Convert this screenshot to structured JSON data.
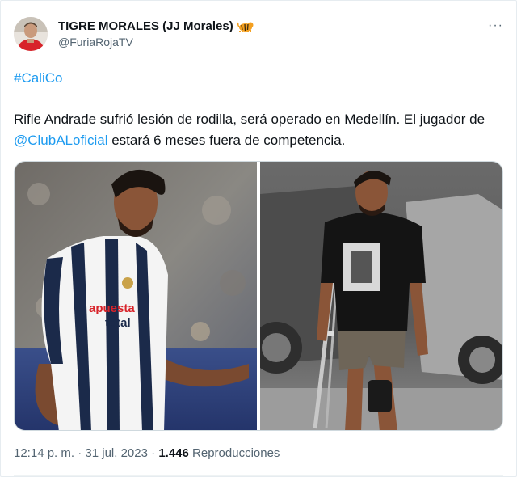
{
  "author": {
    "display_name": "TIGRE MORALES (JJ Morales)",
    "handle": "@FuriaRojaTV",
    "badge_icon": "tiger-emoji"
  },
  "menu": {
    "more_label": "···"
  },
  "tweet": {
    "hashtag": "#CaliCo",
    "text_part1": "Rifle Andrade sufrió lesión de rodilla, será operado en Medellín. El jugador de ",
    "mention": "@ClubALoficial",
    "text_part2": "  estará 6 meses fuera de competencia."
  },
  "meta": {
    "time": "12:14 p. m.",
    "separator": " · ",
    "date": "31 jul. 2023",
    "views_count": "1.446",
    "views_label": "Reproducciones"
  },
  "jersey": {
    "sponsor_line1": "apuesta",
    "sponsor_line2": "total",
    "accent": "#1b2a4a"
  },
  "colors": {
    "link": "#1d9bf0",
    "muted": "#536471"
  }
}
